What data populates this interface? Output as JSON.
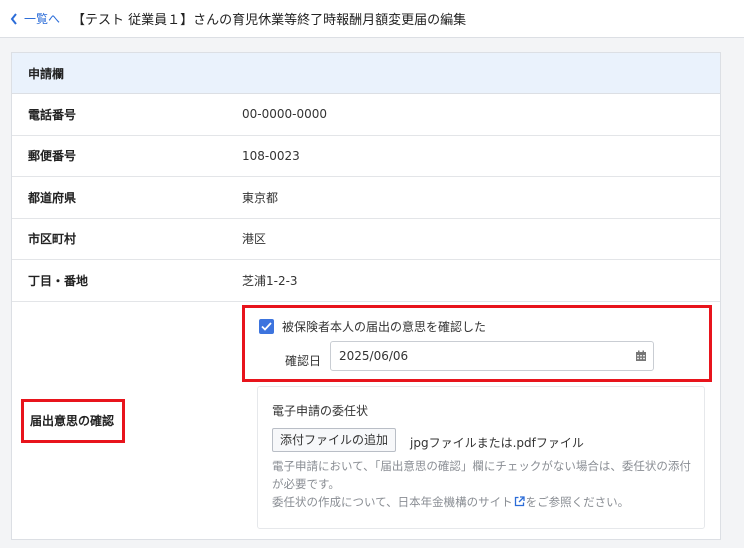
{
  "header": {
    "back_label": "一覧へ",
    "title": "【テスト 従業員１】さんの育児休業等終了時報酬月額変更届の編集"
  },
  "section": {
    "title": "申請欄",
    "rows": [
      {
        "label": "電話番号",
        "value": "00-0000-0000"
      },
      {
        "label": "郵便番号",
        "value": "108-0023"
      },
      {
        "label": "都道府県",
        "value": "東京都"
      },
      {
        "label": "市区町村",
        "value": "港区"
      },
      {
        "label": "丁目・番地",
        "value": "芝浦1-2-3"
      }
    ]
  },
  "confirmation": {
    "label": "届出意思の確認",
    "checkbox_label": "被保険者本人の届出の意思を確認した",
    "checked": true,
    "date_label": "確認日",
    "date_value": "2025/06/06"
  },
  "attachment": {
    "title": "電子申請の委任状",
    "button_label": "添付ファイルの追加",
    "hint": "jpgファイルまたは.pdfファイル",
    "note1": "電子申請において、「届出意思の確認」欄にチェックがない場合は、委任状の添付が必要です。",
    "note2_prefix": "委任状の作成について、",
    "note2_link": "日本年金機構のサイト",
    "note2_suffix": "をご参照ください。"
  },
  "colors": {
    "accent": "#3d74de",
    "highlight": "#e8141c",
    "header_bg": "#eaf2fc"
  }
}
